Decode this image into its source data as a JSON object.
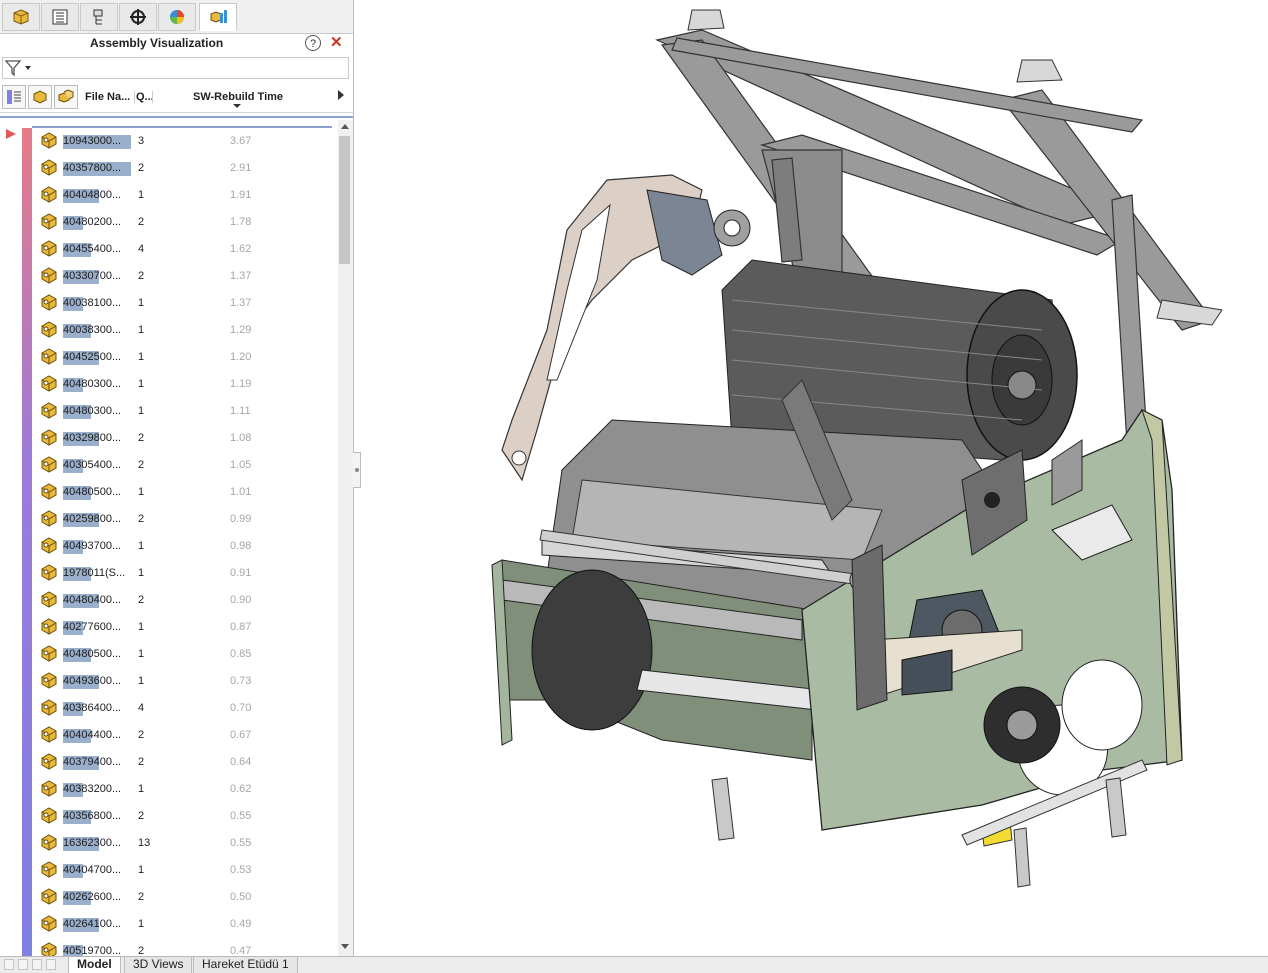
{
  "panel": {
    "tabs": [
      {
        "name": "featuremanager-tab",
        "icon": "featuremanager-icon"
      },
      {
        "name": "propertymanager-tab",
        "icon": "propertymanager-icon"
      },
      {
        "name": "configurationmanager-tab",
        "icon": "configurationmanager-icon"
      },
      {
        "name": "dimxpert-tab",
        "icon": "dimxpert-icon"
      },
      {
        "name": "displaymanager-tab",
        "icon": "displaymanager-icon"
      },
      {
        "name": "assembly-visualization-tab",
        "icon": "assembly-visualization-icon"
      }
    ],
    "title": "Assembly Visualization",
    "help_icon": "help-icon",
    "close_icon": "close-icon",
    "columns": {
      "file_name": "File Na...",
      "quantity": "Q...",
      "rebuild_time": "SW-Rebuild Time"
    }
  },
  "rows": [
    {
      "file": "10943000...",
      "qty": "3",
      "time": "3.67"
    },
    {
      "file": "40357800...",
      "qty": "2",
      "time": "2.91"
    },
    {
      "file": "40404800...",
      "qty": "1",
      "time": "1.91"
    },
    {
      "file": "40480200...",
      "qty": "2",
      "time": "1.78"
    },
    {
      "file": "40455400...",
      "qty": "4",
      "time": "1.62"
    },
    {
      "file": "40330700...",
      "qty": "2",
      "time": "1.37"
    },
    {
      "file": "40038100...",
      "qty": "1",
      "time": "1.37"
    },
    {
      "file": "40038300...",
      "qty": "1",
      "time": "1.29"
    },
    {
      "file": "40452500...",
      "qty": "1",
      "time": "1.20"
    },
    {
      "file": "40480300...",
      "qty": "1",
      "time": "1.19"
    },
    {
      "file": "40480300...",
      "qty": "1",
      "time": "1.11"
    },
    {
      "file": "40329800...",
      "qty": "2",
      "time": "1.08"
    },
    {
      "file": "40305400...",
      "qty": "2",
      "time": "1.05"
    },
    {
      "file": "40480500...",
      "qty": "1",
      "time": "1.01"
    },
    {
      "file": "40259800...",
      "qty": "2",
      "time": "0.99"
    },
    {
      "file": "40493700...",
      "qty": "1",
      "time": "0.98"
    },
    {
      "file": "1978011(S...",
      "qty": "1",
      "time": "0.91"
    },
    {
      "file": "40480400...",
      "qty": "2",
      "time": "0.90"
    },
    {
      "file": "40277600...",
      "qty": "1",
      "time": "0.87"
    },
    {
      "file": "40480500...",
      "qty": "1",
      "time": "0.85"
    },
    {
      "file": "40493600...",
      "qty": "1",
      "time": "0.73"
    },
    {
      "file": "40386400...",
      "qty": "4",
      "time": "0.70"
    },
    {
      "file": "40404400...",
      "qty": "2",
      "time": "0.67"
    },
    {
      "file": "40379400...",
      "qty": "2",
      "time": "0.64"
    },
    {
      "file": "40383200...",
      "qty": "1",
      "time": "0.62"
    },
    {
      "file": "40356800...",
      "qty": "2",
      "time": "0.55"
    },
    {
      "file": "16362300...",
      "qty": "13",
      "time": "0.55"
    },
    {
      "file": "40404700...",
      "qty": "1",
      "time": "0.53"
    },
    {
      "file": "40262600...",
      "qty": "2",
      "time": "0.50"
    },
    {
      "file": "40264100...",
      "qty": "1",
      "time": "0.49"
    },
    {
      "file": "40519700...",
      "qty": "2",
      "time": "0.47"
    }
  ],
  "bottom_tabs": [
    "Model",
    "3D Views",
    "Hareket Etüdü 1"
  ],
  "colors": {
    "highlight": "#9aafcb",
    "gradient_top": "#e77b87",
    "gradient_bottom": "#7f7fe4",
    "close": "#d0341c"
  }
}
